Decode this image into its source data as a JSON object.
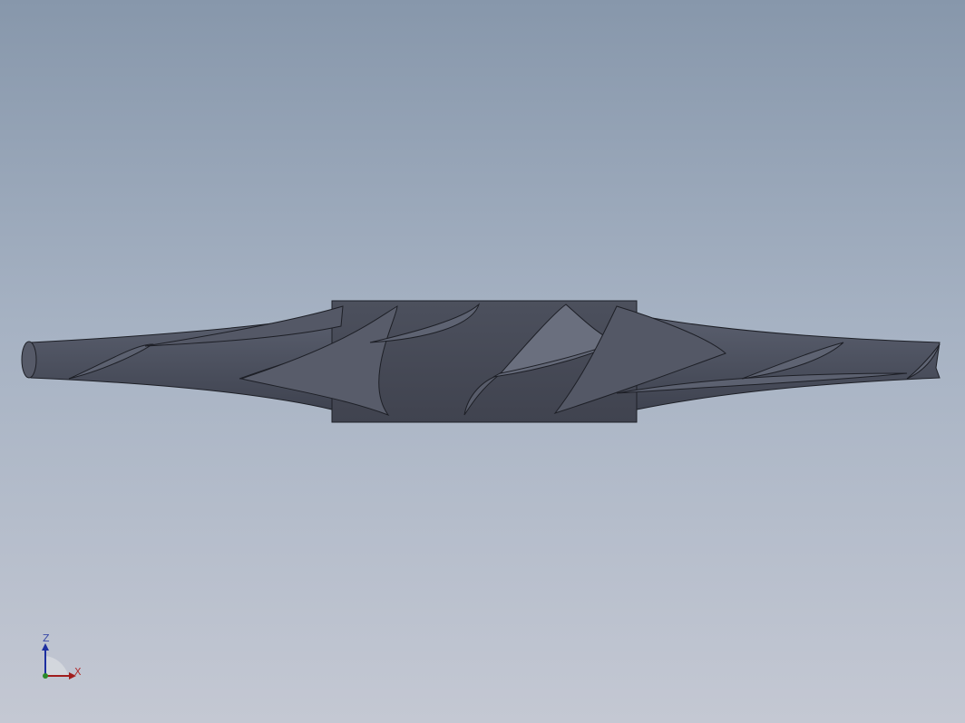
{
  "viewport": {
    "background_top": "#8797ab",
    "background_bottom": "#c4c8d3",
    "model_color": "#4a4e5c"
  },
  "triad": {
    "z_label": "Z",
    "x_label": "X",
    "z_color": "#2233aa",
    "x_color": "#aa1111"
  }
}
